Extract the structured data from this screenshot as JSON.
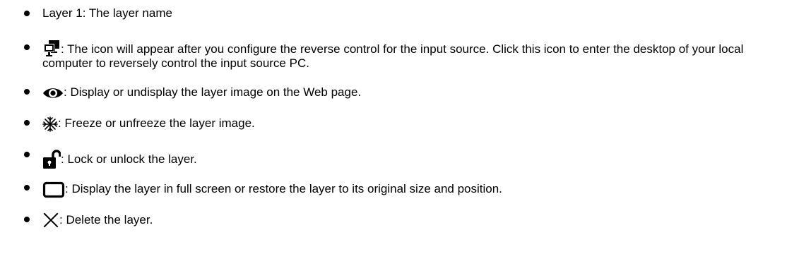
{
  "items": [
    {
      "icon": "",
      "text": "Layer 1: The layer name"
    },
    {
      "icon": "monitor-icon",
      "text": ": The icon will appear after you configure the reverse control for the input source. Click this icon to enter the desktop of your local computer to reversely control the input source PC."
    },
    {
      "icon": "eye-icon",
      "text": ": Display or undisplay the layer image on the Web page."
    },
    {
      "icon": "snowflake-icon",
      "text": ": Freeze or unfreeze the layer image."
    },
    {
      "icon": "unlock-icon",
      "text": ": Lock or unlock the layer."
    },
    {
      "icon": "fullscreen-icon",
      "text": ": Display the layer in full screen or restore the layer to its original size and position."
    },
    {
      "icon": "close-icon",
      "text": ": Delete the layer."
    }
  ]
}
